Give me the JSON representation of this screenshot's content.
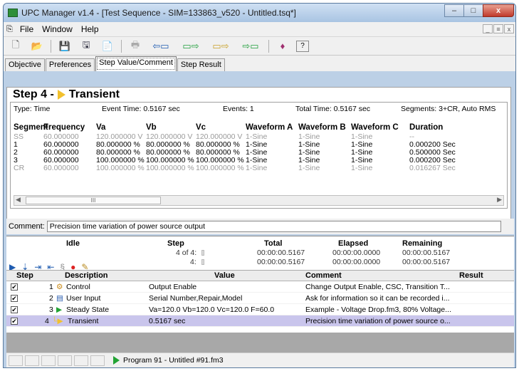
{
  "window": {
    "title": "UPC Manager v1.4 - [Test Sequence - SIM=133863_v520 - Untitled.tsq*]",
    "min": "–",
    "max": "□",
    "close": "x"
  },
  "menu": {
    "items": [
      "File",
      "Window",
      "Help"
    ],
    "mdi": [
      "_",
      "≡",
      "x"
    ]
  },
  "tabs": [
    "Objective",
    "Preferences",
    "Step Value/Comment",
    "Step Result"
  ],
  "active_tab": 2,
  "step": {
    "prefix": "Step 4 - ",
    "name": "Transient",
    "type": "Type: Time",
    "event_time": "Event Time: 0.5167 sec",
    "events": "Events: 1",
    "total_time": "Total Time: 0.5167 sec",
    "segments": "Segments: 3+CR, Auto RMS"
  },
  "segment_headers": [
    "Segment",
    "Frequency",
    "Va",
    "Vb",
    "Vc",
    "Waveform A",
    "Waveform B",
    "Waveform C",
    "Duration"
  ],
  "segments": [
    {
      "seg": "SS",
      "freq": "60.000000",
      "va": "120.000000 V",
      "vb": "120.000000 V",
      "vc": "120.000000 V",
      "wa": "1-Sine",
      "wb": "1-Sine",
      "wc": "1-Sine",
      "dur": "--",
      "dim": true
    },
    {
      "seg": "1",
      "freq": "60.000000",
      "va": "80.000000 %",
      "vb": "80.000000 %",
      "vc": "80.000000 %",
      "wa": "1-Sine",
      "wb": "1-Sine",
      "wc": "1-Sine",
      "dur": "0.000200 Sec",
      "dim": false
    },
    {
      "seg": "2",
      "freq": "60.000000",
      "va": "80.000000 %",
      "vb": "80.000000 %",
      "vc": "80.000000 %",
      "wa": "1-Sine",
      "wb": "1-Sine",
      "wc": "1-Sine",
      "dur": "0.500000 Sec",
      "dim": false
    },
    {
      "seg": "3",
      "freq": "60.000000",
      "va": "100.000000 %",
      "vb": "100.000000 %",
      "vc": "100.000000 %",
      "wa": "1-Sine",
      "wb": "1-Sine",
      "wc": "1-Sine",
      "dur": "0.000200 Sec",
      "dim": false
    },
    {
      "seg": "CR",
      "freq": "60.000000",
      "va": "100.000000 %",
      "vb": "100.000000 %",
      "vc": "100.000000 %",
      "wa": "1-Sine",
      "wb": "1-Sine",
      "wc": "1-Sine",
      "dur": "0.016267 Sec",
      "dim": true
    }
  ],
  "scroll_thumb": "III",
  "comment": {
    "label": "Comment:",
    "value": "Precision time variation of power source output"
  },
  "status": {
    "state": "Idle",
    "step_label": "Step",
    "step_of": "4 of 4:",
    "step_cur": "4:",
    "total_label": "Total",
    "total1": "00:00:00.5167",
    "total2": "00:00:00.5167",
    "elapsed_label": "Elapsed",
    "elapsed1": "00:00:00.0000",
    "elapsed2": "00:00:00.0000",
    "remaining_label": "Remaining",
    "remaining1": "00:00:00.5167",
    "remaining2": "00:00:00.5167"
  },
  "grid_headers": [
    "Step",
    "Description",
    "Value",
    "Comment",
    "Result"
  ],
  "grid_rows": [
    {
      "num": "1",
      "desc": "Control",
      "value": "Output Enable",
      "comment": "Change Output Enable, CSC, Transition T...",
      "checked": "✔"
    },
    {
      "num": "2",
      "desc": "User Input",
      "value": "Serial Number,Repair,Model",
      "comment": "Ask for information so it can be recorded i...",
      "checked": "✔"
    },
    {
      "num": "3",
      "desc": "Steady State",
      "value": "Va=120.0 Vb=120.0 Vc=120.0 F=60.0",
      "comment": "Example - Voltage Drop.fm3, 80% Voltage...",
      "checked": "✔"
    },
    {
      "num": "4",
      "desc": "Transient",
      "value": "0.5167 sec",
      "comment": "Precision time variation of power source o...",
      "checked": "✔"
    }
  ],
  "statusbar": {
    "text": "Program 91 - Untitled #91.fm3"
  }
}
